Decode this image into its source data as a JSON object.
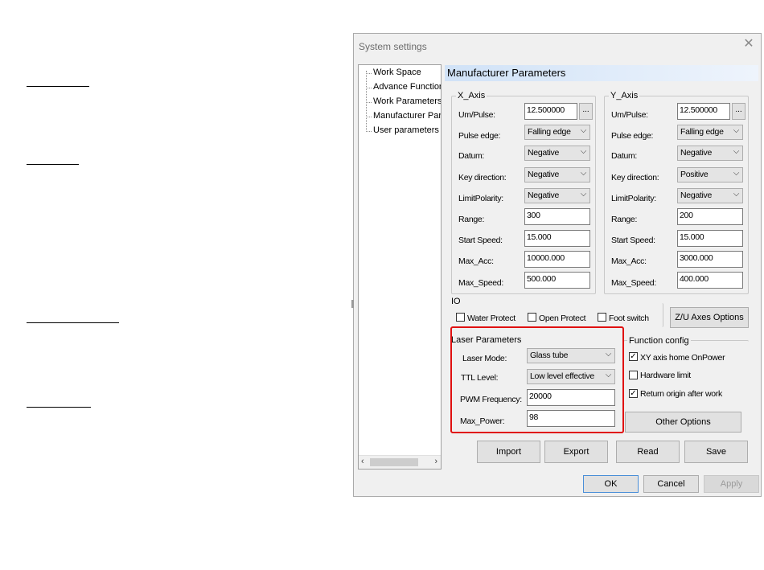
{
  "window": {
    "title": "System settings"
  },
  "tree": {
    "items": [
      "Work Space",
      "Advance Functions",
      "Work Parameters",
      "Manufacturer Parameters",
      "User parameters"
    ]
  },
  "panel": {
    "header": "Manufacturer Parameters"
  },
  "x_axis": {
    "label": "X_Axis",
    "um_pulse_label": "Um/Pulse:",
    "um_pulse": "12.500000",
    "pulse_edge_label": "Pulse edge:",
    "pulse_edge": "Falling edge",
    "datum_label": "Datum:",
    "datum": "Negative",
    "key_direction_label": "Key direction:",
    "key_direction": "Negative",
    "limit_polarity_label": "LimitPolarity:",
    "limit_polarity": "Negative",
    "range_label": "Range:",
    "range": "300",
    "start_speed_label": "Start Speed:",
    "start_speed": "15.000",
    "max_acc_label": "Max_Acc:",
    "max_acc": "10000.000",
    "max_speed_label": "Max_Speed:",
    "max_speed": "500.000"
  },
  "y_axis": {
    "label": "Y_Axis",
    "um_pulse_label": "Um/Pulse:",
    "um_pulse": "12.500000",
    "pulse_edge_label": "Pulse edge:",
    "pulse_edge": "Falling edge",
    "datum_label": "Datum:",
    "datum": "Negative",
    "key_direction_label": "Key direction:",
    "key_direction": "Positive",
    "limit_polarity_label": "LimitPolarity:",
    "limit_polarity": "Negative",
    "range_label": "Range:",
    "range": "200",
    "start_speed_label": "Start Speed:",
    "start_speed": "15.000",
    "max_acc_label": "Max_Acc:",
    "max_acc": "3000.000",
    "max_speed_label": "Max_Speed:",
    "max_speed": "400.000"
  },
  "io": {
    "label": "IO",
    "water_protect": "Water Protect",
    "open_protect": "Open Protect",
    "foot_switch": "Foot switch"
  },
  "zu_axes_button": "Z/U Axes Options",
  "laser": {
    "label": "Laser Parameters",
    "mode_label": "Laser Mode:",
    "mode": "Glass tube",
    "ttl_label": "TTL Level:",
    "ttl": "Low level effective",
    "pwm_label": "PWM Frequency:",
    "pwm": "20000",
    "max_power_label": "Max_Power:",
    "max_power": "98"
  },
  "function_config": {
    "label": "Function config",
    "xy_home": "XY axis home OnPower",
    "xy_home_checked": true,
    "hardware_limit": "Hardware limit",
    "hardware_limit_checked": false,
    "return_origin": "Return origin after work",
    "return_origin_checked": true
  },
  "other_options_button": "Other Options",
  "actions": {
    "import": "Import",
    "export": "Export",
    "read": "Read",
    "save": "Save"
  },
  "footer": {
    "ok": "OK",
    "cancel": "Cancel",
    "apply": "Apply"
  },
  "colors": {
    "highlight": "#e01010",
    "header_gradient": "#d0e2f7"
  }
}
